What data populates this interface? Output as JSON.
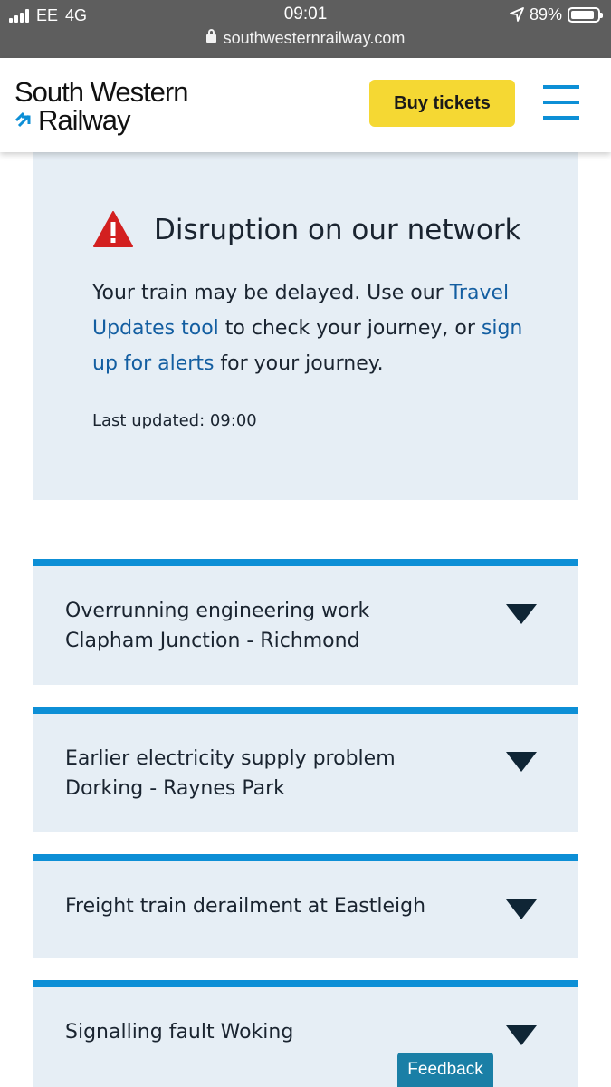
{
  "status_bar": {
    "carrier": "EE",
    "network": "4G",
    "time": "09:01",
    "battery": "89%",
    "battery_level": 0.89,
    "url": "southwesternrailway.com"
  },
  "header": {
    "logo_line1": "South Western",
    "logo_line2": "Railway",
    "buy_tickets_label": "Buy tickets",
    "colors": {
      "button": "#f5d833",
      "accent": "#0d8fd6"
    }
  },
  "disruption": {
    "title": "Disruption on our network",
    "text_1": "Your train may be delayed. Use our ",
    "link_1": "Travel Updates tool",
    "text_2": " to check your journey, or ",
    "link_2": "sign up for alerts",
    "text_3": " for your journey.",
    "last_updated": "Last updated: 09:00",
    "icon": "warning-triangle-icon",
    "colors": {
      "icon": "#d32020",
      "link": "#135ea1",
      "panel": "#e6eef5"
    }
  },
  "incidents": [
    {
      "line1": "Overrunning engineering work",
      "line2": "Clapham Junction - Richmond"
    },
    {
      "line1": "Earlier electricity supply problem",
      "line2": "Dorking - Raynes Park"
    },
    {
      "line1": "Freight train derailment at Eastleigh"
    },
    {
      "line1": "Signalling fault Woking"
    }
  ],
  "feedback_label": "Feedback"
}
